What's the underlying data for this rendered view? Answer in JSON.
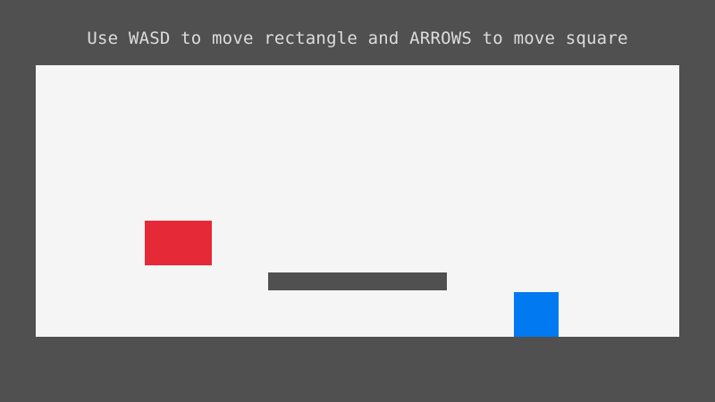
{
  "instructions": "Use WASD to move rectangle and ARROWS to move square",
  "colors": {
    "background": "#505050",
    "text": "#dcdcdc",
    "playfield": "#f5f5f5",
    "rectangle": "#e62937",
    "platform": "#505050",
    "square": "#0079f1"
  }
}
